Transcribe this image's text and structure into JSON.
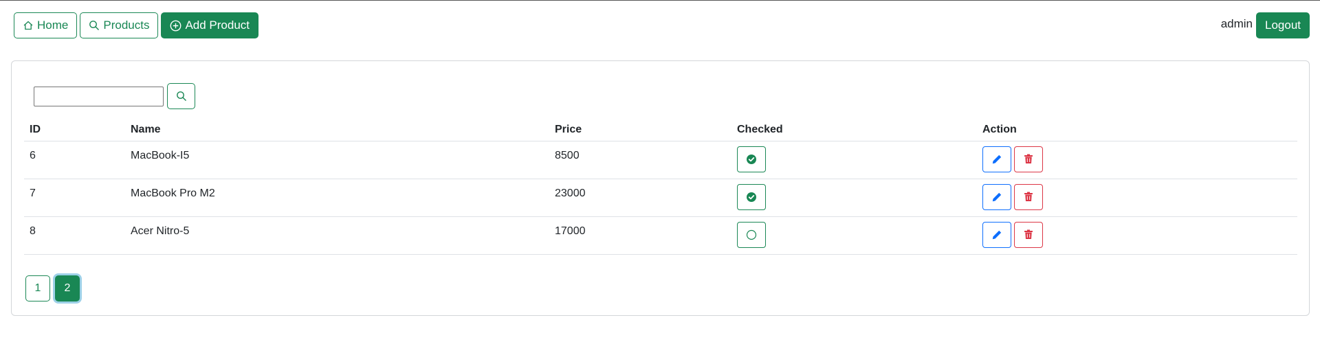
{
  "nav": {
    "home_label": "Home",
    "products_label": "Products",
    "add_product_label": "Add Product"
  },
  "user": {
    "name": "admin",
    "logout_label": "Logout"
  },
  "search": {
    "value": "",
    "placeholder": ""
  },
  "table": {
    "headers": [
      "ID",
      "Name",
      "Price",
      "Checked",
      "Action"
    ],
    "rows": [
      {
        "id": "6",
        "name": "MacBook-I5",
        "price": "8500",
        "checked": true
      },
      {
        "id": "7",
        "name": "MacBook Pro M2",
        "price": "23000",
        "checked": true
      },
      {
        "id": "8",
        "name": "Acer Nitro-5",
        "price": "17000",
        "checked": false
      }
    ]
  },
  "pagination": {
    "pages": [
      "1",
      "2"
    ],
    "current": "2"
  },
  "colors": {
    "primary_green": "#198754",
    "edit_blue": "#0d6efd",
    "delete_red": "#dc3545"
  }
}
